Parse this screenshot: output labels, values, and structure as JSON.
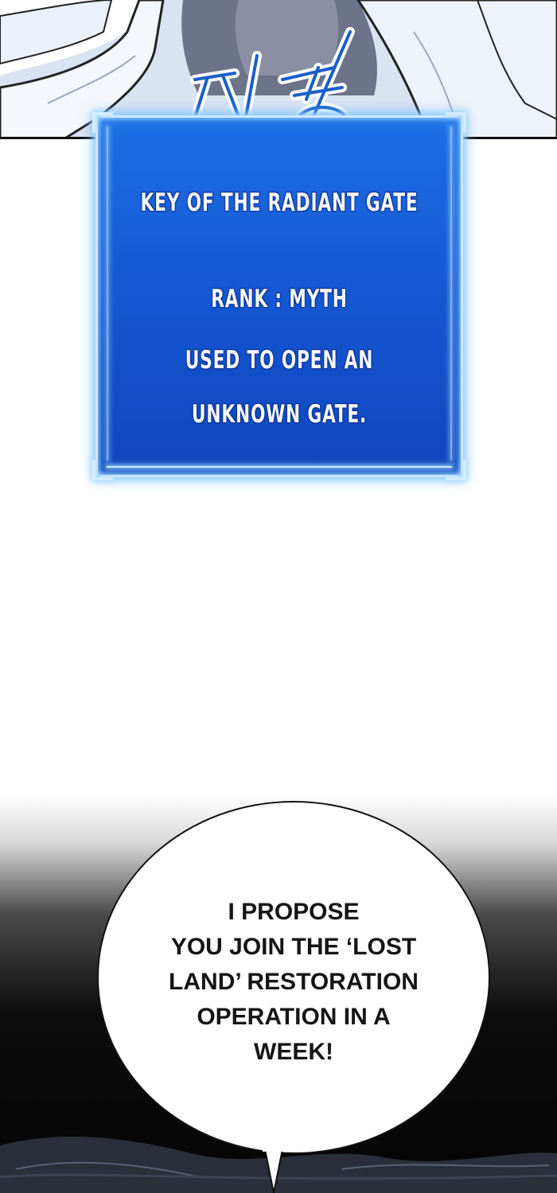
{
  "sfx": "띠링",
  "status_window": {
    "item_name": "KEY OF THE RADIANT GATE",
    "rank": "RANK : MYTH",
    "description_lines": [
      "USED TO OPEN AN",
      "UNKNOWN GATE."
    ]
  },
  "speech_bubble": {
    "lines": [
      "I PROPOSE",
      "YOU JOIN THE ‘LOST",
      "LAND’ RESTORATION",
      "OPERATION IN A",
      "WEEK!"
    ]
  },
  "colors": {
    "window_blue": "#1559d4",
    "window_glow": "#8fd0ff",
    "text_white": "#f4f8ff",
    "ink": "#111111"
  }
}
